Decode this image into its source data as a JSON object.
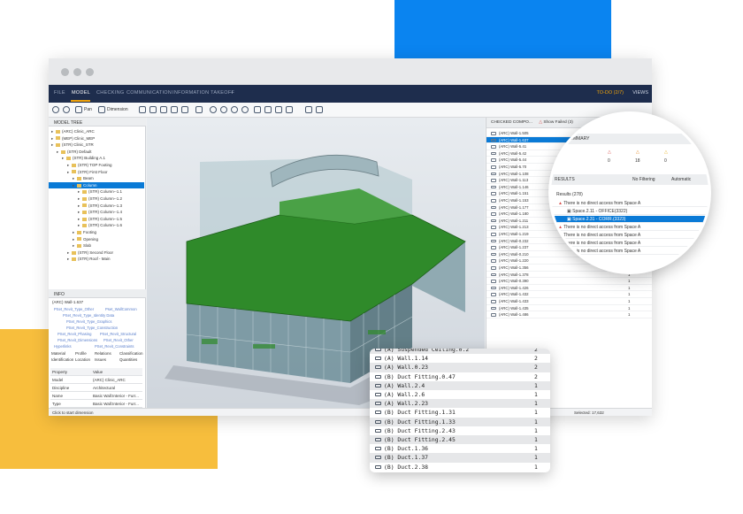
{
  "menu": {
    "items": [
      "FILE",
      "MODEL",
      "CHECKING",
      "COMMUNICATION",
      "INFORMATION TAKEOFF",
      "+"
    ],
    "active": "MODEL",
    "todo": "TO-DO (2/7)",
    "views": "VIEWS"
  },
  "toolbar": {
    "pan_label": "Pan",
    "dimension_label": "Dimension",
    "search_placeholder": "Search"
  },
  "model_tree": {
    "title": "MODEL TREE",
    "rows": [
      {
        "label": "(ARC) Clinic_ARC",
        "indent": 0
      },
      {
        "label": "(MEP) Clinic_MEP",
        "indent": 0
      },
      {
        "label": "(STR) Clinic_STR",
        "indent": 0
      },
      {
        "label": "(STR) Default",
        "indent": 1
      },
      {
        "label": "(STR) Building A.1",
        "indent": 2
      },
      {
        "label": "(STR) TOP Footing",
        "indent": 3
      },
      {
        "label": "(STR) First Floor",
        "indent": 3
      },
      {
        "label": "Beam",
        "indent": 4
      },
      {
        "label": "Column",
        "indent": 4,
        "selected": true
      },
      {
        "label": "(STR) Column--1.1",
        "indent": 5
      },
      {
        "label": "(STR) Column--1.2",
        "indent": 5
      },
      {
        "label": "(STR) Column--1.3",
        "indent": 5
      },
      {
        "label": "(STR) Column--1.4",
        "indent": 5
      },
      {
        "label": "(STR) Column--1.5",
        "indent": 5
      },
      {
        "label": "(STR) Column--1.6",
        "indent": 5
      },
      {
        "label": "Footing",
        "indent": 4
      },
      {
        "label": "Opening",
        "indent": 4
      },
      {
        "label": "Slab",
        "indent": 4
      },
      {
        "label": "(STR) Second Floor",
        "indent": 3
      },
      {
        "label": "(STR) Roof - Main",
        "indent": 3
      }
    ]
  },
  "info": {
    "title": "INFO",
    "element": "(ARC) Wall-1.637",
    "links": [
      "PSet_Revit_Type_Other",
      "Pset_WallCommon",
      "PSet_Revit_Type_Identity Data",
      "PSet_Revit_Type_Graphics",
      "PSet_Revit_Type_Construction",
      "PSet_Revit_Phasing",
      "PSet_Revit_Structural",
      "PSet_Revit_Dimensions",
      "PSet_Revit_Other",
      "Hyperlinks",
      "PSet_Revit_Constraints"
    ],
    "tabs_row1": [
      "Material",
      "Profile",
      "Relations",
      "Classification"
    ],
    "tabs_row2": [
      "Identification",
      "Location",
      "Issues",
      "Quantities"
    ],
    "prop_header": [
      "Property",
      "Value"
    ],
    "props": [
      {
        "key": "Model",
        "value": "(ARC) Clinic_ARC"
      },
      {
        "key": "Discipline",
        "value": "Architectural"
      },
      {
        "key": "Name",
        "value": "Basic Wall:Interior - Furr..."
      },
      {
        "key": "Type",
        "value": "Basic Wall:Interior - Furr..."
      }
    ]
  },
  "view3d": {
    "label": "3D"
  },
  "checked": {
    "title": "CHECKED COMPO...",
    "filter": "Show Failed (3)",
    "rows": [
      {
        "name": "(ARC) Wall-1.505",
        "count": ""
      },
      {
        "name": "(ARC) Wall-1.637",
        "count": "",
        "selected": true
      },
      {
        "name": "(ARC) Wall-5.41",
        "count": ""
      },
      {
        "name": "(ARC) Wall-5.42",
        "count": ""
      },
      {
        "name": "(ARC) Wall-5.44",
        "count": ""
      },
      {
        "name": "(ARC) Wall-5.70",
        "count": ""
      },
      {
        "name": "(ARC) Wall-1.108",
        "count": ""
      },
      {
        "name": "(ARC) Wall-1.113",
        "count": ""
      },
      {
        "name": "(ARC) Wall-1.146",
        "count": ""
      },
      {
        "name": "(ARC) Wall-1.151",
        "count": ""
      },
      {
        "name": "(ARC) Wall-1.153",
        "count": ""
      },
      {
        "name": "(ARC) Wall-1.177",
        "count": ""
      },
      {
        "name": "(ARC) Wall-1.180",
        "count": ""
      },
      {
        "name": "(ARC) Wall-1.211",
        "count": ""
      },
      {
        "name": "(ARC) Wall-1.213",
        "count": ""
      },
      {
        "name": "(ARC) Wall-1.219",
        "count": ""
      },
      {
        "name": "(ARC) Wall-0.232",
        "count": "1"
      },
      {
        "name": "(ARC) Wall-1.237",
        "count": "1"
      },
      {
        "name": "(ARC) Wall-0.210",
        "count": "1"
      },
      {
        "name": "(ARC) Wall-1.220",
        "count": "1"
      },
      {
        "name": "(ARC) Wall-1.356",
        "count": "1"
      },
      {
        "name": "(ARC) Wall-1.378",
        "count": "1"
      },
      {
        "name": "(ARC) Wall-0.390",
        "count": "1"
      },
      {
        "name": "(ARC) Wall-1.426",
        "count": "1"
      },
      {
        "name": "(ARC) Wall-1.432",
        "count": "1"
      },
      {
        "name": "(ARC) Wall-1.433",
        "count": "1"
      },
      {
        "name": "(ARC) Wall-1.435",
        "count": "1"
      },
      {
        "name": "(ARC) Wall-1.486",
        "count": "1"
      }
    ]
  },
  "status": {
    "left": "Click to start dimension",
    "right": "Selected: 17,632"
  },
  "zoom": {
    "summary": "SUMMARY",
    "counts": [
      "0",
      "18",
      "0"
    ],
    "results_tab": "RESULTS",
    "filtering": "No Filtering",
    "automatic": "Automatic",
    "results_header": "Results (278)",
    "rows": [
      {
        "label": "There is no direct access from Space A",
        "indent": 0
      },
      {
        "label": "Space.2.11 - OFFICE(3322)",
        "indent": 1
      },
      {
        "label": "Space.2.31 - CORR.(3323)",
        "indent": 1,
        "selected": true
      },
      {
        "label": "There is no direct access from Space A",
        "indent": 0
      },
      {
        "label": "There is no direct access from Space A",
        "indent": 0
      },
      {
        "label": "There is no direct access from Space A",
        "indent": 0
      },
      {
        "label": "There is no direct access from Space A",
        "indent": 0
      }
    ]
  },
  "popup": {
    "rows": [
      {
        "name": "(A) Suspended Ceiling.0.2",
        "count": "2"
      },
      {
        "name": "(A) Wall.1.14",
        "count": "2"
      },
      {
        "name": "(A) Wall.0.23",
        "count": "2"
      },
      {
        "name": "(B) Duct Fitting.0.47",
        "count": "2"
      },
      {
        "name": "(A) Wall.2.4",
        "count": "1"
      },
      {
        "name": "(A) Wall.2.6",
        "count": "1"
      },
      {
        "name": "(A) Wall.2.23",
        "count": "1"
      },
      {
        "name": "(B) Duct Fitting.1.31",
        "count": "1"
      },
      {
        "name": "(B) Duct Fitting.1.33",
        "count": "1"
      },
      {
        "name": "(B) Duct Fitting.2.43",
        "count": "1"
      },
      {
        "name": "(B) Duct Fitting.2.45",
        "count": "1"
      },
      {
        "name": "(B) Duct.1.36",
        "count": "1"
      },
      {
        "name": "(B) Duct.1.37",
        "count": "1"
      },
      {
        "name": "(B) Duct.2.38",
        "count": "1"
      }
    ]
  },
  "colors": {
    "accent_blue": "#0a84f0",
    "accent_yellow": "#f7be3d",
    "menubar": "#1e2d4d",
    "todo": "#f0a30a",
    "selection": "#0a7ad6",
    "roof_green": "#2f8a2a"
  }
}
